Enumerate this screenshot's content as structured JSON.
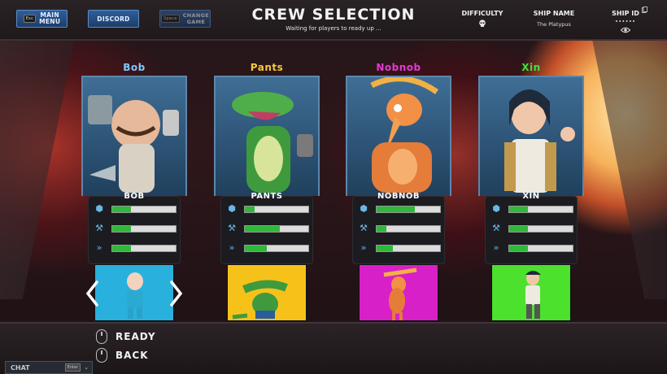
{
  "topbar": {
    "main_menu": {
      "key": "Esc",
      "label_line1": "MAIN",
      "label_line2": "MENU"
    },
    "discord": {
      "label": "DISCORD"
    },
    "change_game": {
      "key": "Space",
      "label_line1": "CHANGE",
      "label_line2": "GAME"
    },
    "title": "CREW SELECTION",
    "subtitle": "Waiting for players to ready up ...",
    "difficulty": {
      "label": "DIFFICULTY",
      "icon": "skull-icon"
    },
    "ship_name": {
      "label": "SHIP NAME",
      "value": "The Platypus"
    },
    "ship_id": {
      "label": "SHIP ID",
      "value": "••••••",
      "icon": "eye-icon"
    }
  },
  "crew": [
    {
      "top_name": "Bob",
      "name": "BOB",
      "name_color": "#7ec8ff",
      "slot_color": "#ffffff",
      "stats": [
        0.3,
        0.3,
        0.3
      ],
      "selected": true
    },
    {
      "top_name": "Pants",
      "name": "PANTS",
      "name_color": "#f5c83a",
      "slot_color": "#f6c21a",
      "stats": [
        0.15,
        0.55,
        0.35
      ],
      "selected": false
    },
    {
      "top_name": "Nobnob",
      "name": "NOBNOB",
      "name_color": "#e23ad2",
      "slot_color": "#d820c8",
      "stats": [
        0.6,
        0.15,
        0.25
      ],
      "selected": false
    },
    {
      "top_name": "Xin",
      "name": "XIN",
      "name_color": "#42e03a",
      "slot_color": "#4be12c",
      "stats": [
        0.3,
        0.3,
        0.3
      ],
      "selected": false
    }
  ],
  "stat_icons": [
    "shield-icon",
    "wrench-icon",
    "speed-icon"
  ],
  "controls": {
    "ready": "READY",
    "back": "BACK"
  },
  "chat": {
    "label": "CHAT",
    "key": "Enter"
  }
}
